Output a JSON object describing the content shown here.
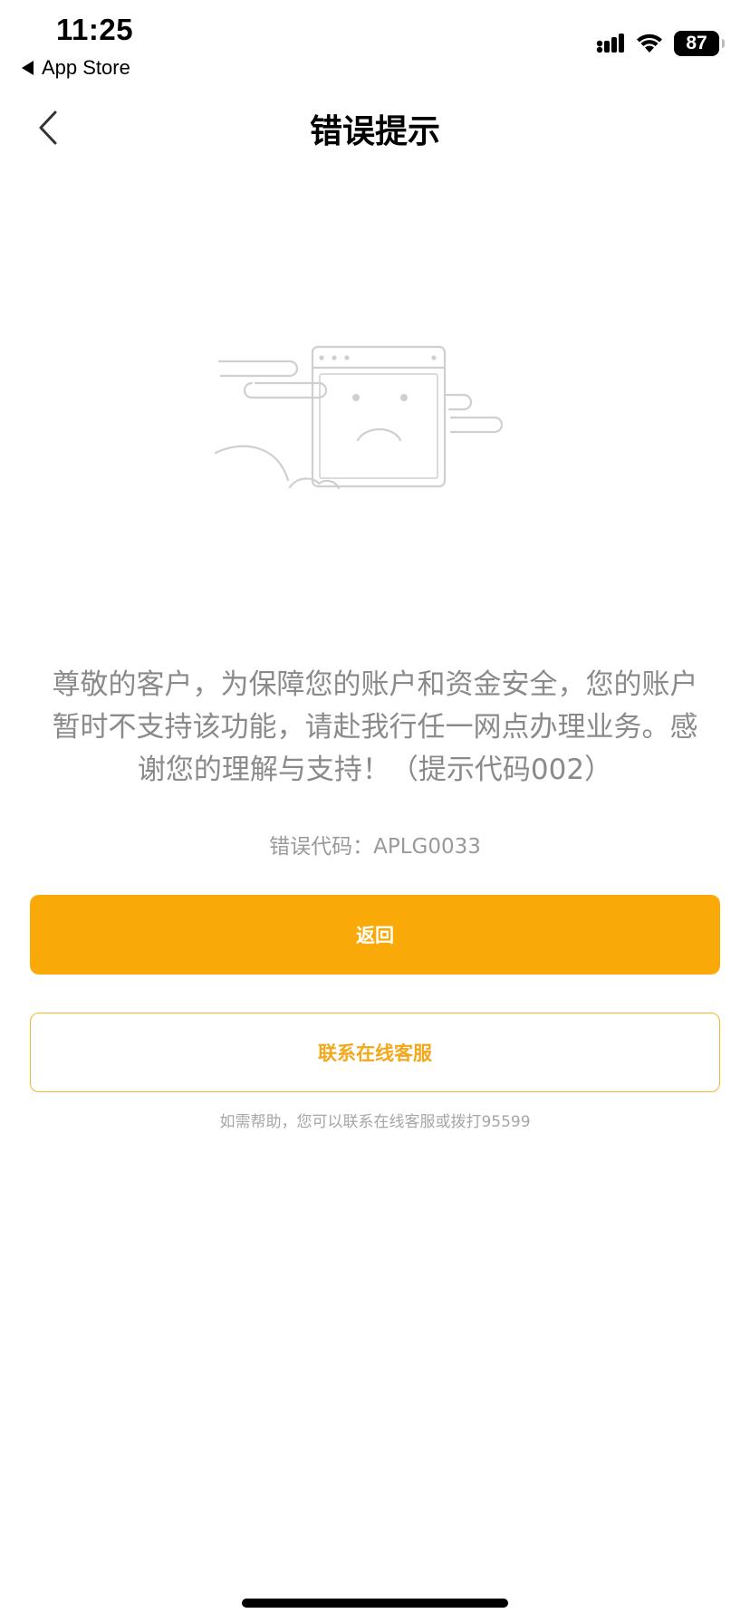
{
  "status_bar": {
    "time": "11:25",
    "back_app": "App Store",
    "battery": "87",
    "icons": [
      "signal-icon",
      "wifi-icon",
      "battery-icon"
    ]
  },
  "nav": {
    "title": "错误提示",
    "back_icon": "chevron-left-icon"
  },
  "illustration": {
    "icon": "sad-browser-window-illustration"
  },
  "message": {
    "line1": "尊敬的客户，为保障您的账户和资金安全，您的账户",
    "line2": "暂时不支持该功能，请赴我行任一网点办理业务。感",
    "line3": "谢您的理解与支持！（提示代码002）"
  },
  "error_code": "错误代码：APLG0033",
  "buttons": {
    "back": "返回",
    "contact": "联系在线客服"
  },
  "help_text": "如需帮助，您可以联系在线客服或拨打95599",
  "colors": {
    "primary": "#f9aa08",
    "outline": "#f2b82f",
    "message_text": "#8a8a8a"
  }
}
